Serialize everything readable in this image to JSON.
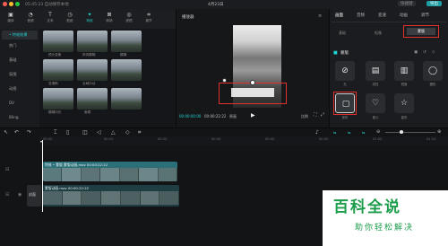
{
  "window": {
    "title": "4月23日"
  },
  "top_left_info": "05:45:23 自动保存本地",
  "top_right": {
    "button": "快捷键",
    "export": "导出"
  },
  "toolbar": [
    {
      "label": "媒体",
      "icon": "media-icon"
    },
    {
      "label": "音频",
      "icon": "audio-icon"
    },
    {
      "label": "文本",
      "icon": "text-icon"
    },
    {
      "label": "贴纸",
      "icon": "sticker-icon"
    },
    {
      "label": "特效",
      "icon": "effects-icon"
    },
    {
      "label": "转场",
      "icon": "transition-icon"
    },
    {
      "label": "滤镜",
      "icon": "filter-icon"
    },
    {
      "label": "调节",
      "icon": "adjust-icon"
    }
  ],
  "sidebar": [
    "• 特效效果",
    "热门",
    "基础",
    "氛围",
    "动感",
    "DV",
    "Bling"
  ],
  "media_items": [
    "镜头变焦",
    "斜向模糊",
    "模糊",
    "变清晰",
    "全局抖动",
    "",
    "模糊闪光",
    "鱼眼",
    ""
  ],
  "player": {
    "title": "播放器",
    "time_current": "00:00:00:00",
    "time_total": "00:00:22:22",
    "quality": "原画",
    "ratio": "比例"
  },
  "right_panel": {
    "tabs": [
      "画面",
      "音频",
      "变速",
      "动画",
      "调节"
    ],
    "subtabs": [
      "基础",
      "抠像",
      "蒙版"
    ],
    "section": "蒙版",
    "masks": [
      "无",
      "线性",
      "镜面",
      "圆形",
      "矩形",
      "爱心",
      "星形"
    ]
  },
  "timeline": {
    "ruler": [
      "00:00",
      "00:10",
      "00:20",
      "00:30",
      "00:40",
      "00:50",
      "01:00",
      "01:10"
    ],
    "clip1": {
      "label": "特效 • 蒙版   蒙版动画.mov   00:00:22:22"
    },
    "clip2": {
      "label": "蒙版动画.mov   00:00:22:22"
    },
    "track_label": "封面"
  },
  "watermark": {
    "title": "百科全说",
    "subtitle": "助你轻松解决"
  },
  "colors": {
    "accent": "#22d3d3",
    "highlight": "#e0322c",
    "watermark": "#1b9d4b"
  }
}
